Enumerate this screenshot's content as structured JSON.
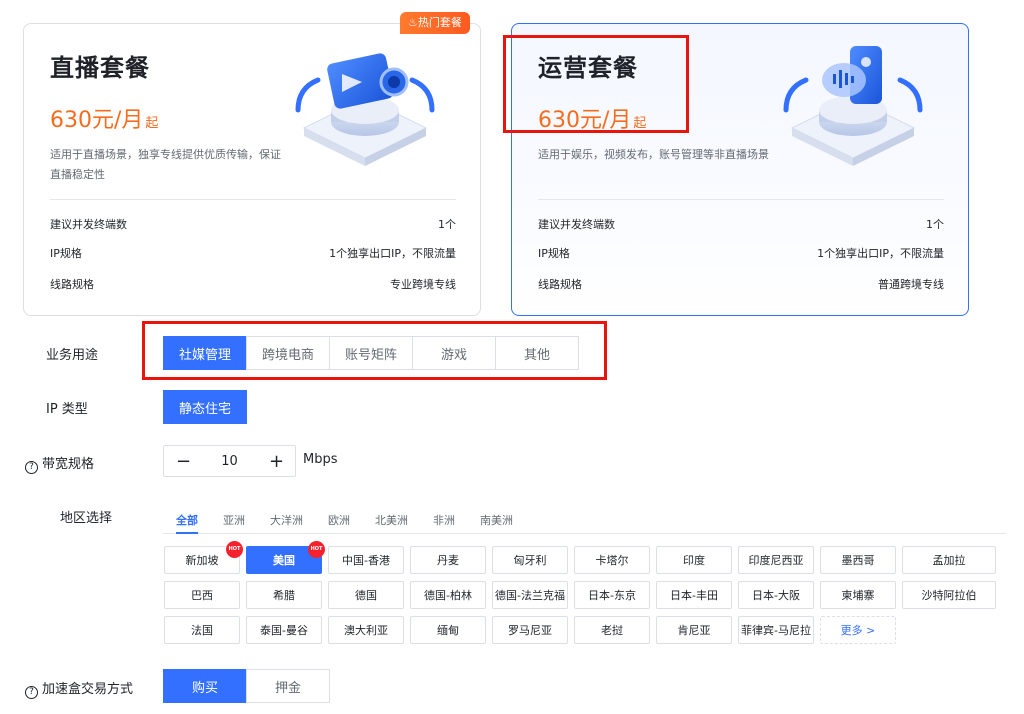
{
  "cards": [
    {
      "title": "直播套餐",
      "price": "630元/月",
      "price_suffix": "起",
      "desc": "适用于直播场景，独享专线提供优质传输，保证直播稳定性",
      "rows": [
        {
          "label": "建议并发终端数",
          "value": "1个"
        },
        {
          "label": "IP规格",
          "value": "1个独享出口IP，不限流量"
        },
        {
          "label": "线路规格",
          "value": "专业跨境专线"
        }
      ],
      "tag": "♨热门套餐",
      "illustration": "camera-icon"
    },
    {
      "title": "运营套餐",
      "price": "630元/月",
      "price_suffix": "起",
      "desc": "适用于娱乐，视频发布，账号管理等非直播场景",
      "rows": [
        {
          "label": "建议并发终端数",
          "value": "1个"
        },
        {
          "label": "IP规格",
          "value": "1个独享出口IP，不限流量"
        },
        {
          "label": "线路规格",
          "value": "普通跨境专线"
        }
      ],
      "illustration": "phone-chat-icon"
    }
  ],
  "form": {
    "usage": {
      "label": "业务用途",
      "options": [
        "社媒管理",
        "跨境电商",
        "账号矩阵",
        "游戏",
        "其他"
      ],
      "selected": "社媒管理"
    },
    "ip_type": {
      "label": "IP 类型",
      "options": [
        "静态住宅"
      ],
      "selected": "静态住宅"
    },
    "bandwidth": {
      "label": "带宽规格",
      "minus": "−",
      "value": "10",
      "plus": "+",
      "unit": "Mbps"
    },
    "region": {
      "label": "地区选择",
      "tabs": [
        "全部",
        "亚洲",
        "大洋洲",
        "欧洲",
        "北美洲",
        "非洲",
        "南美洲"
      ],
      "active_tab": "全部",
      "chips": [
        "新加坡",
        "美国",
        "中国-香港",
        "丹麦",
        "匈牙利",
        "卡塔尔",
        "印度",
        "印度尼西亚",
        "墨西哥",
        "孟加拉",
        "巴西",
        "希腊",
        "德国",
        "德国-柏林",
        "德国-法兰克福",
        "日本-东京",
        "日本-丰田",
        "日本-大阪",
        "柬埔寨",
        "沙特阿拉伯",
        "法国",
        "泰国-曼谷",
        "澳大利亚",
        "缅甸",
        "罗马尼亚",
        "老挝",
        "肯尼亚",
        "菲律宾-马尼拉",
        "更多 >"
      ],
      "selected": "美国",
      "hot_badge": "HOT"
    },
    "trade": {
      "label": "加速盒交易方式",
      "options": [
        "购买",
        "押金"
      ],
      "selected": "购买"
    }
  },
  "colors": {
    "accent": "#3370ff",
    "price": "#f56c1f",
    "highlight": "#e8140e",
    "hot": "#f5222d"
  }
}
